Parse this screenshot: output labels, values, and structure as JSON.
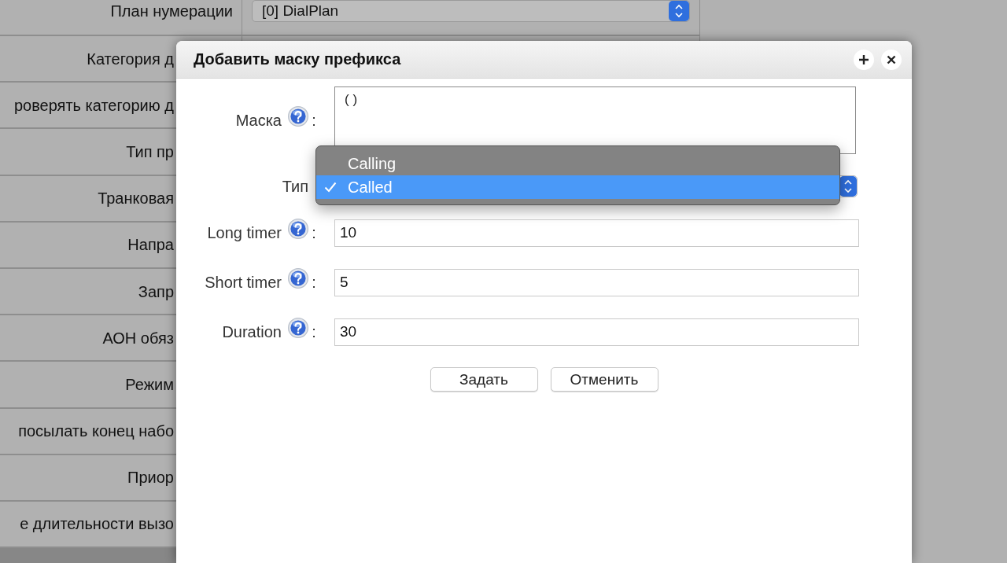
{
  "background_form": {
    "rows": [
      {
        "label": "План нумерации",
        "value": "[0] DialPlan"
      },
      {
        "label": "Категория д"
      },
      {
        "label": "роверять категорию д"
      },
      {
        "label": "Тип пр"
      },
      {
        "label": "Транковая"
      },
      {
        "label": "Напра"
      },
      {
        "label": "Запр"
      },
      {
        "label": "АОН обяз"
      },
      {
        "label": "Режим"
      },
      {
        "label": "посылать конец набо"
      },
      {
        "label": "Приор"
      },
      {
        "label": "е длительности вызо"
      }
    ]
  },
  "dialog": {
    "title": "Добавить маску префикса",
    "fields": [
      {
        "kind": "textarea",
        "label": "Маска",
        "help": true,
        "separator": ":",
        "value": "( )"
      },
      {
        "kind": "select",
        "label": "Тип",
        "help": false,
        "options": [
          {
            "label": "Calling",
            "selected": false
          },
          {
            "label": "Called",
            "selected": true
          }
        ]
      },
      {
        "kind": "input",
        "label": "Long timer",
        "help": true,
        "separator": ":",
        "value": "10"
      },
      {
        "kind": "input",
        "label": "Short timer",
        "help": true,
        "separator": ":",
        "value": "5"
      },
      {
        "kind": "input",
        "label": "Duration",
        "help": true,
        "separator": ":",
        "value": "30"
      }
    ],
    "buttons": [
      "Задать",
      "Отменить"
    ]
  }
}
